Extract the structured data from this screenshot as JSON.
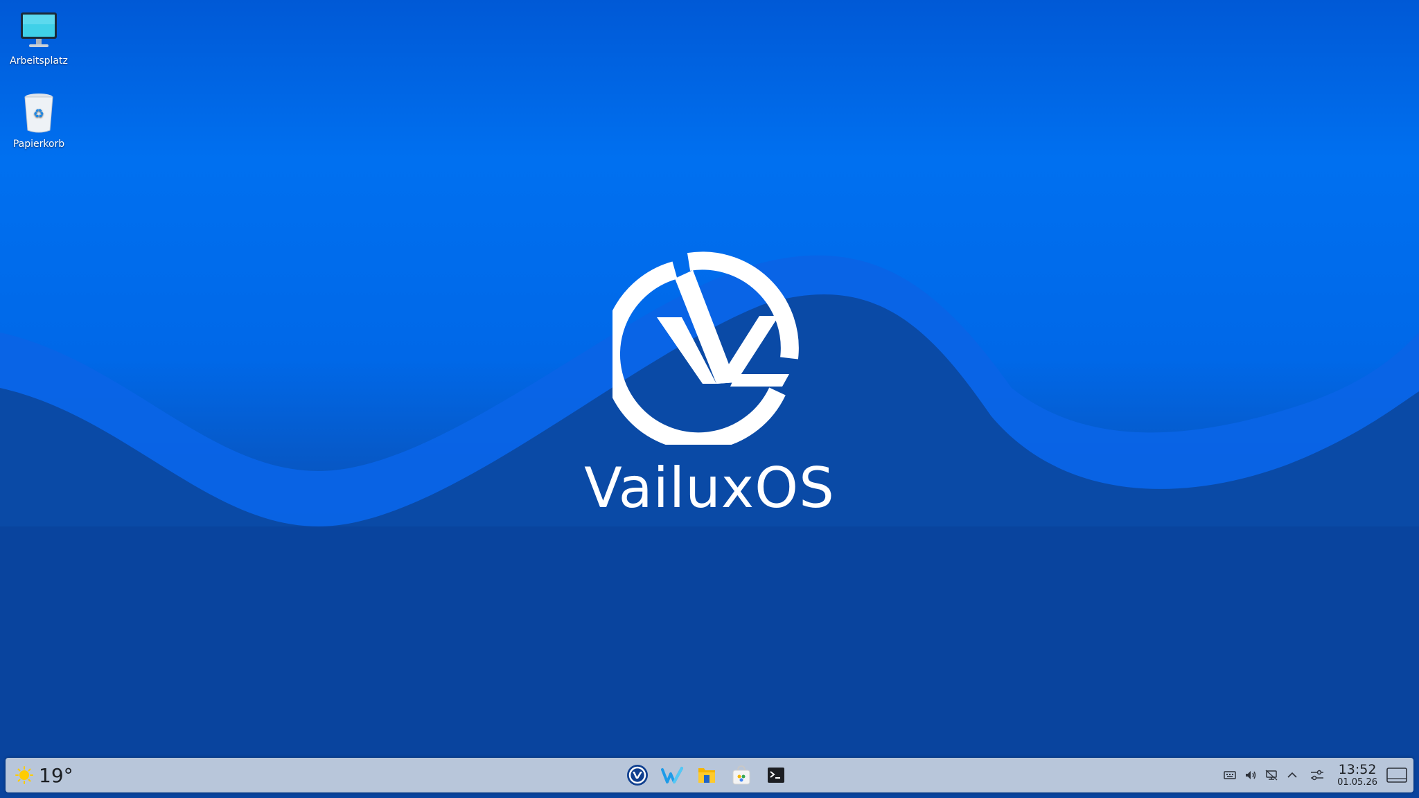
{
  "desktop": {
    "icons": [
      {
        "label": "Arbeitsplatz",
        "icon": "computer-monitor-icon"
      },
      {
        "label": "Papierkorb",
        "icon": "trash-bin-icon"
      }
    ],
    "wallpaper": {
      "brand_name": "VailuxOS",
      "colors": {
        "sky": "#0070f0",
        "wave_light": "#0a64e6",
        "wave_dark": "#0a4aa6",
        "bottom": "#083a8e"
      }
    }
  },
  "taskbar": {
    "background": "#b8c6da",
    "weather": {
      "temperature": "19°",
      "icon": "sun-icon"
    },
    "apps": [
      {
        "name": "vailux-launcher",
        "icon": "vailux-logo-icon"
      },
      {
        "name": "web-browser",
        "icon": "browser-w-icon"
      },
      {
        "name": "file-manager",
        "icon": "folder-icon"
      },
      {
        "name": "software-store",
        "icon": "store-bag-icon"
      },
      {
        "name": "terminal",
        "icon": "terminal-icon"
      }
    ],
    "tray": {
      "icons": [
        "keyboard-icon",
        "volume-icon",
        "network-icon",
        "chevron-up-icon",
        "settings-sliders-icon"
      ],
      "clock": {
        "time": "13:52",
        "date": "01.05.26"
      }
    }
  }
}
